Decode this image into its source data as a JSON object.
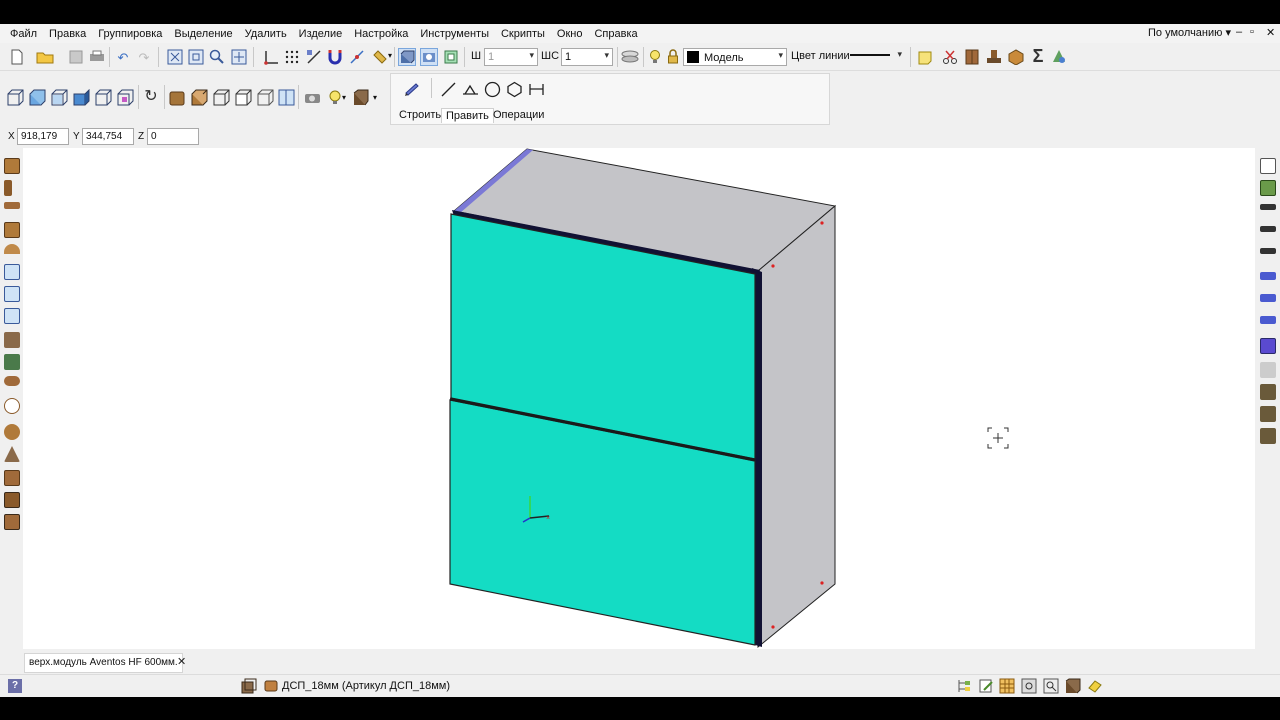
{
  "menu": {
    "items": [
      "Файл",
      "Правка",
      "Группировка",
      "Выделение",
      "Удалить",
      "Изделие",
      "Настройка",
      "Инструменты",
      "Скрипты",
      "Окно",
      "Справка"
    ],
    "preset": "По умолчанию",
    "window_controls": [
      "–",
      "▫",
      "✕"
    ]
  },
  "toolbar1": {
    "w_label": "Ш",
    "w_value": "1",
    "ws_label": "ШС",
    "ws_value": "1",
    "layer_value": "Модель",
    "line_color_label": "Цвет линии"
  },
  "ribbon": {
    "tabs": [
      "Строить",
      "Править",
      "Операции"
    ],
    "active_tab": "Править"
  },
  "coords": {
    "x_label": "X",
    "x_value": "918,179",
    "y_label": "Y",
    "y_value": "344,754",
    "z_label": "Z",
    "z_value": "0"
  },
  "document": {
    "tab_label": "верх.модуль Aventos HF 600мм.",
    "close": "✕"
  },
  "status": {
    "help": "?",
    "material": "ДСП_18мм (Артикул ДСП_18мм)"
  },
  "colors": {
    "front_panel": "#14dcc4",
    "side_panel": "#c4c4c8",
    "edge_band": "#7b79d6",
    "dark_edge": "#111133"
  },
  "icons": {
    "cursor": "crosshair-cursor-icon",
    "axes": "axis-triad-icon"
  }
}
